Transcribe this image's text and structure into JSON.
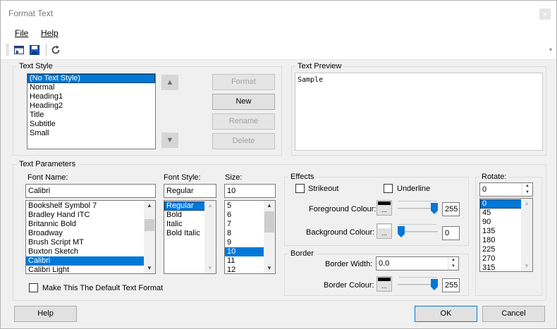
{
  "window": {
    "title": "Format Text",
    "close_glyph": "×"
  },
  "menu": {
    "file": "File",
    "help": "Help"
  },
  "toolbar": {
    "buttons": [
      "open-style-icon",
      "save-icon",
      "refresh-icon"
    ],
    "overflow_glyph": "▾"
  },
  "text_style": {
    "legend": "Text Style",
    "items": [
      "(No Text Style)",
      "Normal",
      "Heading1",
      "Heading2",
      "Title",
      "Subtitle",
      "Small"
    ],
    "selected_index": 0,
    "up_glyph": "▲",
    "down_glyph": "▼",
    "buttons": {
      "format": "Format",
      "new": "New",
      "rename": "Rename",
      "delete": "Delete"
    }
  },
  "preview": {
    "legend": "Text Preview",
    "text": "Sample"
  },
  "params": {
    "legend": "Text Parameters",
    "font_name_label": "Font Name:",
    "font_name_value": "Calibri",
    "fonts": [
      "Bookshelf Symbol 7",
      "Bradley Hand ITC",
      "Britannic Bold",
      "Broadway",
      "Brush Script MT",
      "Buxton Sketch",
      "Calibri",
      "Calibri Light"
    ],
    "font_selected_index": 6,
    "font_style_label": "Font Style:",
    "font_style_value": "Regular",
    "styles": [
      "Regular",
      "Bold",
      "Italic",
      "Bold Italic"
    ],
    "style_selected_index": 0,
    "size_label": "Size:",
    "size_value": "10",
    "sizes": [
      "5",
      "6",
      "7",
      "8",
      "9",
      "10",
      "11",
      "12"
    ],
    "size_selected_index": 5,
    "default_label": "Make This The Default Text Format",
    "default_checked": false
  },
  "effects": {
    "legend": "Effects",
    "strikeout": "Strikeout",
    "strikeout_checked": false,
    "underline": "Underline",
    "underline_checked": false,
    "fg_label": "Foreground Colour:",
    "fg_value": "255",
    "fg_level": 1.0,
    "fg_color": "#000000",
    "bg_label": "Background Colour:",
    "bg_value": "0",
    "bg_level": 0.0,
    "bg_color": "#ffffff",
    "ellipsis": "..."
  },
  "border": {
    "legend": "Border",
    "width_label": "Border Width:",
    "width_value": "0.0",
    "colour_label": "Border Colour:",
    "colour_value": "255",
    "colour_level": 1.0,
    "colour_swatch": "#000000",
    "ellipsis": "..."
  },
  "rotate": {
    "legend": "Rotate:",
    "value": "0",
    "items": [
      "0",
      "45",
      "90",
      "135",
      "180",
      "225",
      "270",
      "315"
    ],
    "selected_index": 0
  },
  "footer": {
    "help": "Help",
    "ok": "OK",
    "cancel": "Cancel"
  },
  "colors": {
    "accent": "#0078d7",
    "thumb": "#0078d7"
  }
}
